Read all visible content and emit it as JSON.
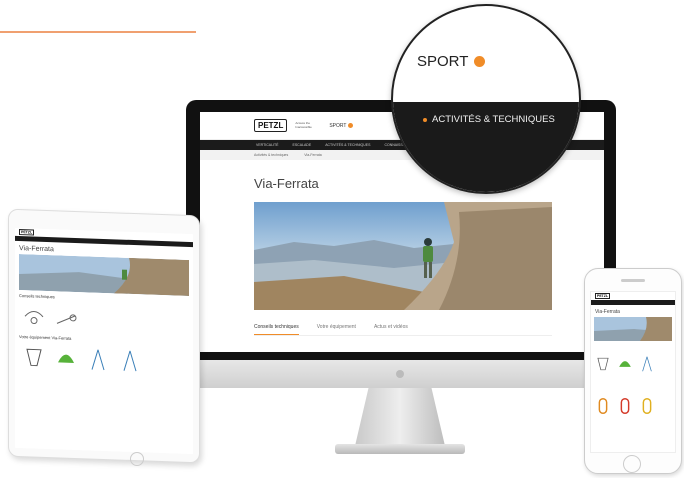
{
  "colors": {
    "accent": "#f08c28",
    "nav_dark": "#1a1a1a",
    "text_dark": "#333333"
  },
  "site": {
    "logo": "PETZL",
    "tagline": "Access the Inaccessible",
    "section": "SPORT"
  },
  "desktop": {
    "nav": [
      "VERTICALITÉ",
      "ESCALADE",
      "ACTIVITÉS & TECHNIQUES",
      "CONNAISSANCES"
    ],
    "breadcrumb": [
      "Activités & techniques",
      "Via-Ferrata"
    ],
    "title": "Via-Ferrata",
    "tabs": [
      {
        "label": "Conseils techniques",
        "active": true
      },
      {
        "label": "Votre équipement",
        "active": false
      },
      {
        "label": "Actus et vidéos",
        "active": false
      }
    ]
  },
  "zoom": {
    "sport_label": "SPORT",
    "nav_item": "ACTIVITÉS & TECHNIQUES"
  },
  "tablet": {
    "title": "Via-Ferrata",
    "section_advice": "Conseils techniques",
    "section_gear": "Votre équipement Via-Ferrata"
  },
  "phone": {
    "title": "Via-Ferrata"
  }
}
